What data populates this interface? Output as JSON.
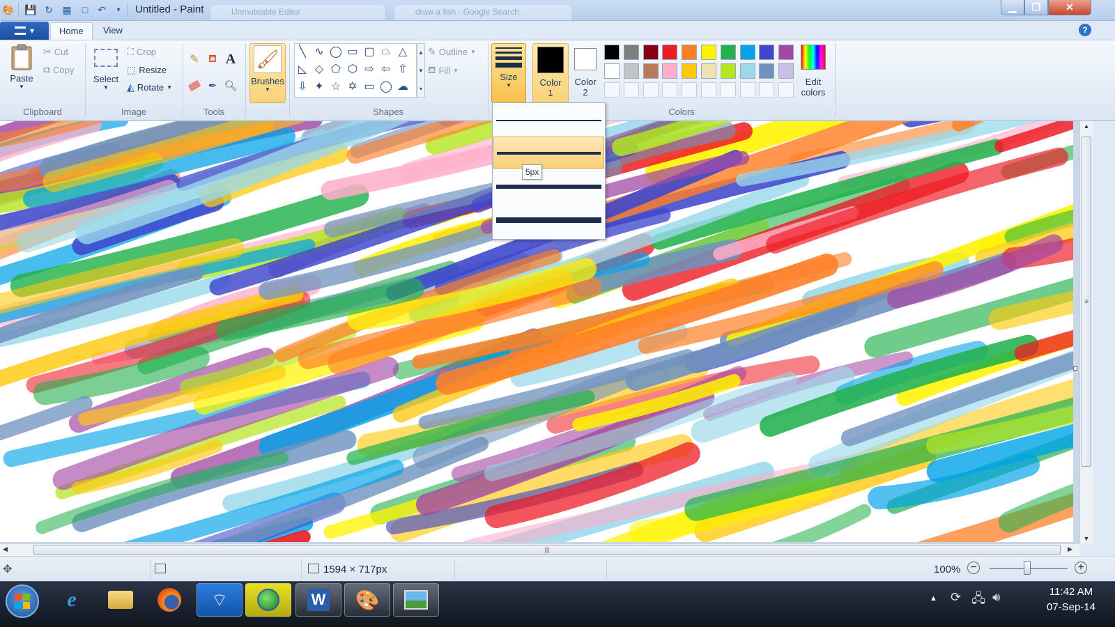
{
  "window": {
    "title": "Untitled - Paint",
    "background_tabs": [
      "Unmuteable Editor",
      "draw a fish - Google Search"
    ]
  },
  "ribbon_tabs": {
    "file_menu": "▾",
    "home": "Home",
    "view": "View"
  },
  "clipboard": {
    "paste": "Paste",
    "cut": "Cut",
    "copy": "Copy",
    "group_label": "Clipboard"
  },
  "image": {
    "select": "Select",
    "crop": "Crop",
    "resize": "Resize",
    "rotate": "Rotate",
    "group_label": "Image"
  },
  "tools": {
    "group_label": "Tools"
  },
  "brushes": {
    "label": "Brushes"
  },
  "shapes": {
    "outline": "Outline",
    "fill": "Fill",
    "group_label": "Shapes"
  },
  "size": {
    "label": "Size",
    "options": [
      "1px",
      "3px",
      "5px",
      "8px"
    ],
    "selected": "3px",
    "tooltip": "5px"
  },
  "colors": {
    "color1_line1": "Color",
    "color1_line2": "1",
    "color2_line1": "Color",
    "color2_line2": "2",
    "edit_line1": "Edit",
    "edit_line2": "colors",
    "group_label": "Colors",
    "color1_value": "#000000",
    "color2_value": "#ffffff",
    "palette_row1": [
      "#000000",
      "#7f7f7f",
      "#880015",
      "#ed1c24",
      "#ff7f27",
      "#fff200",
      "#22b14c",
      "#00a2e8",
      "#3f48cc",
      "#a349a4"
    ],
    "palette_row2": [
      "#ffffff",
      "#c3c3c3",
      "#b97a57",
      "#ffaec9",
      "#ffc90e",
      "#efe4b0",
      "#b5e61d",
      "#99d9ea",
      "#7092be",
      "#c8bfe7"
    ]
  },
  "status": {
    "canvas_size": "1594 × 717px",
    "zoom": "100%"
  },
  "taskbar": {
    "time": "11:42 AM",
    "date": "07-Sep-14"
  }
}
